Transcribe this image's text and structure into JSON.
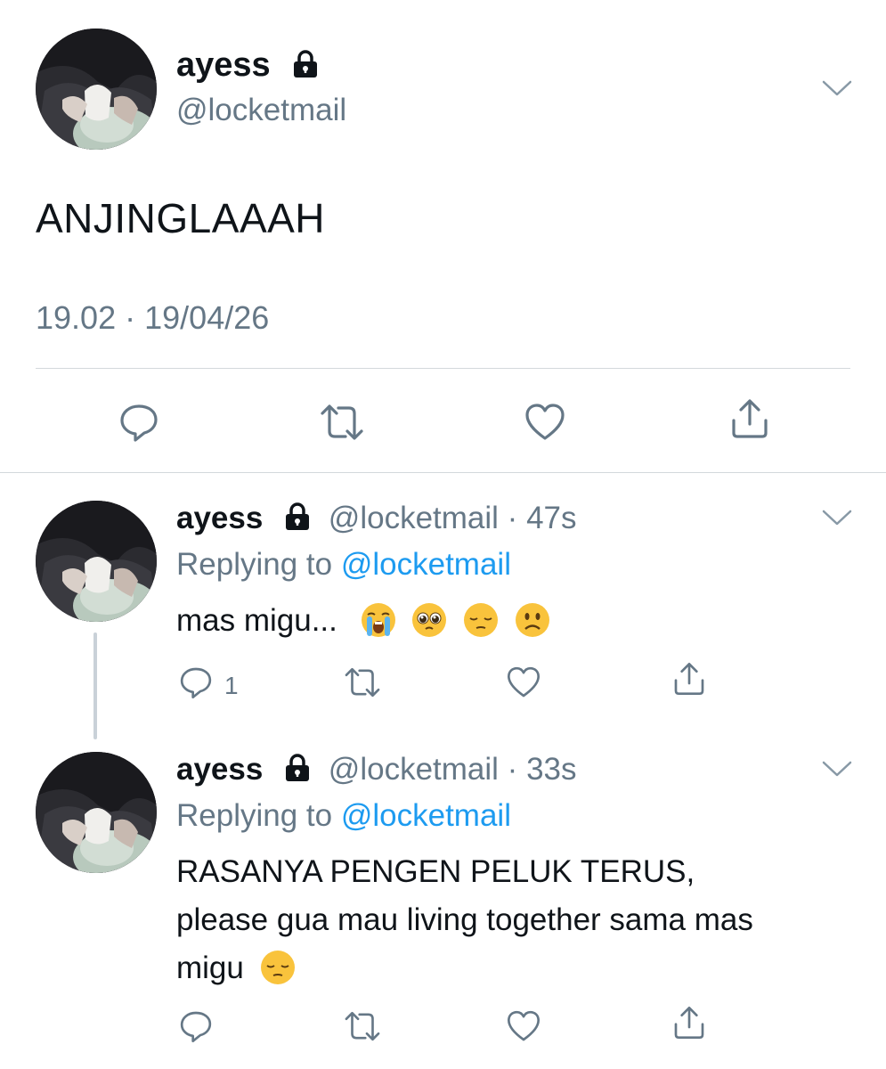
{
  "main_tweet": {
    "name": "ayess",
    "handle": "@locketmail",
    "text": "ANJINGLAAAH",
    "time": "19.02",
    "separator": "·",
    "date": "19/04/26",
    "icons": [
      "lock-icon",
      "chevron-down-icon",
      "reply-icon",
      "retweet-icon",
      "like-icon",
      "share-icon"
    ]
  },
  "replies": [
    {
      "name": "ayess",
      "handle": "@locketmail",
      "separator": "·",
      "time": "47s",
      "replying_to_label": "Replying to",
      "replying_to_handle": "@locketmail",
      "text": "mas migu...",
      "emojis": [
        "loudly-crying-face",
        "pleading-face",
        "pensive-face",
        "frowning-face"
      ],
      "reply_count": "1"
    },
    {
      "name": "ayess",
      "handle": "@locketmail",
      "separator": "·",
      "time": "33s",
      "replying_to_label": "Replying to",
      "replying_to_handle": "@locketmail",
      "text_line1": "RASANYA PENGEN PELUK TERUS,",
      "text_line2": "please gua mau living together sama mas",
      "text_line3": "migu",
      "emojis": [
        "pensive-face"
      ]
    }
  ],
  "colors": {
    "text": "#0f1419",
    "secondary": "#657786",
    "link": "#1d9bf0",
    "divider": "#d3d8dc",
    "emoji_yellow": "#f9c33c"
  }
}
